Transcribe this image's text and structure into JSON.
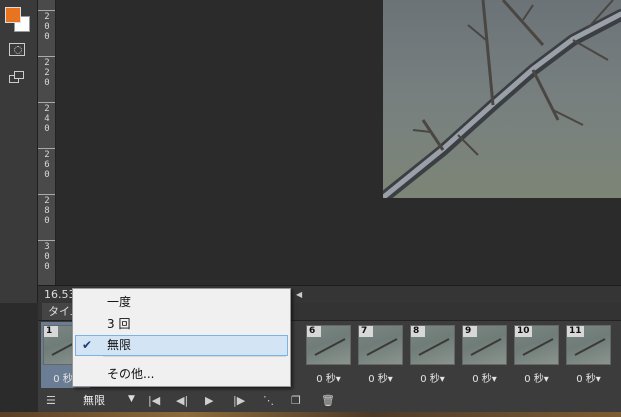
{
  "ruler": {
    "labels": [
      "200",
      "220",
      "240",
      "260",
      "280",
      "300"
    ]
  },
  "status": {
    "zoom": "16.53"
  },
  "timeline": {
    "tab_label": "タイム",
    "loop_value": "無限",
    "frames": [
      {
        "number": "1",
        "delay": "0 秒▾",
        "selected": true
      },
      {
        "number": "6",
        "delay": "0 秒▾"
      },
      {
        "number": "7",
        "delay": "0 秒▾"
      },
      {
        "number": "8",
        "delay": "0 秒▾"
      },
      {
        "number": "9",
        "delay": "0 秒▾"
      },
      {
        "number": "10",
        "delay": "0 秒▾"
      },
      {
        "number": "11",
        "delay": "0 秒▾"
      }
    ]
  },
  "loop_menu": {
    "items": [
      {
        "label": "一度",
        "checked": false
      },
      {
        "label": "3 回",
        "checked": false
      },
      {
        "label": "無限",
        "checked": true
      },
      {
        "label": "その他...",
        "checked": false
      }
    ]
  },
  "colors": {
    "foreground": "#e8741f",
    "background": "#ffffff",
    "selection": "#d3e5f5"
  }
}
